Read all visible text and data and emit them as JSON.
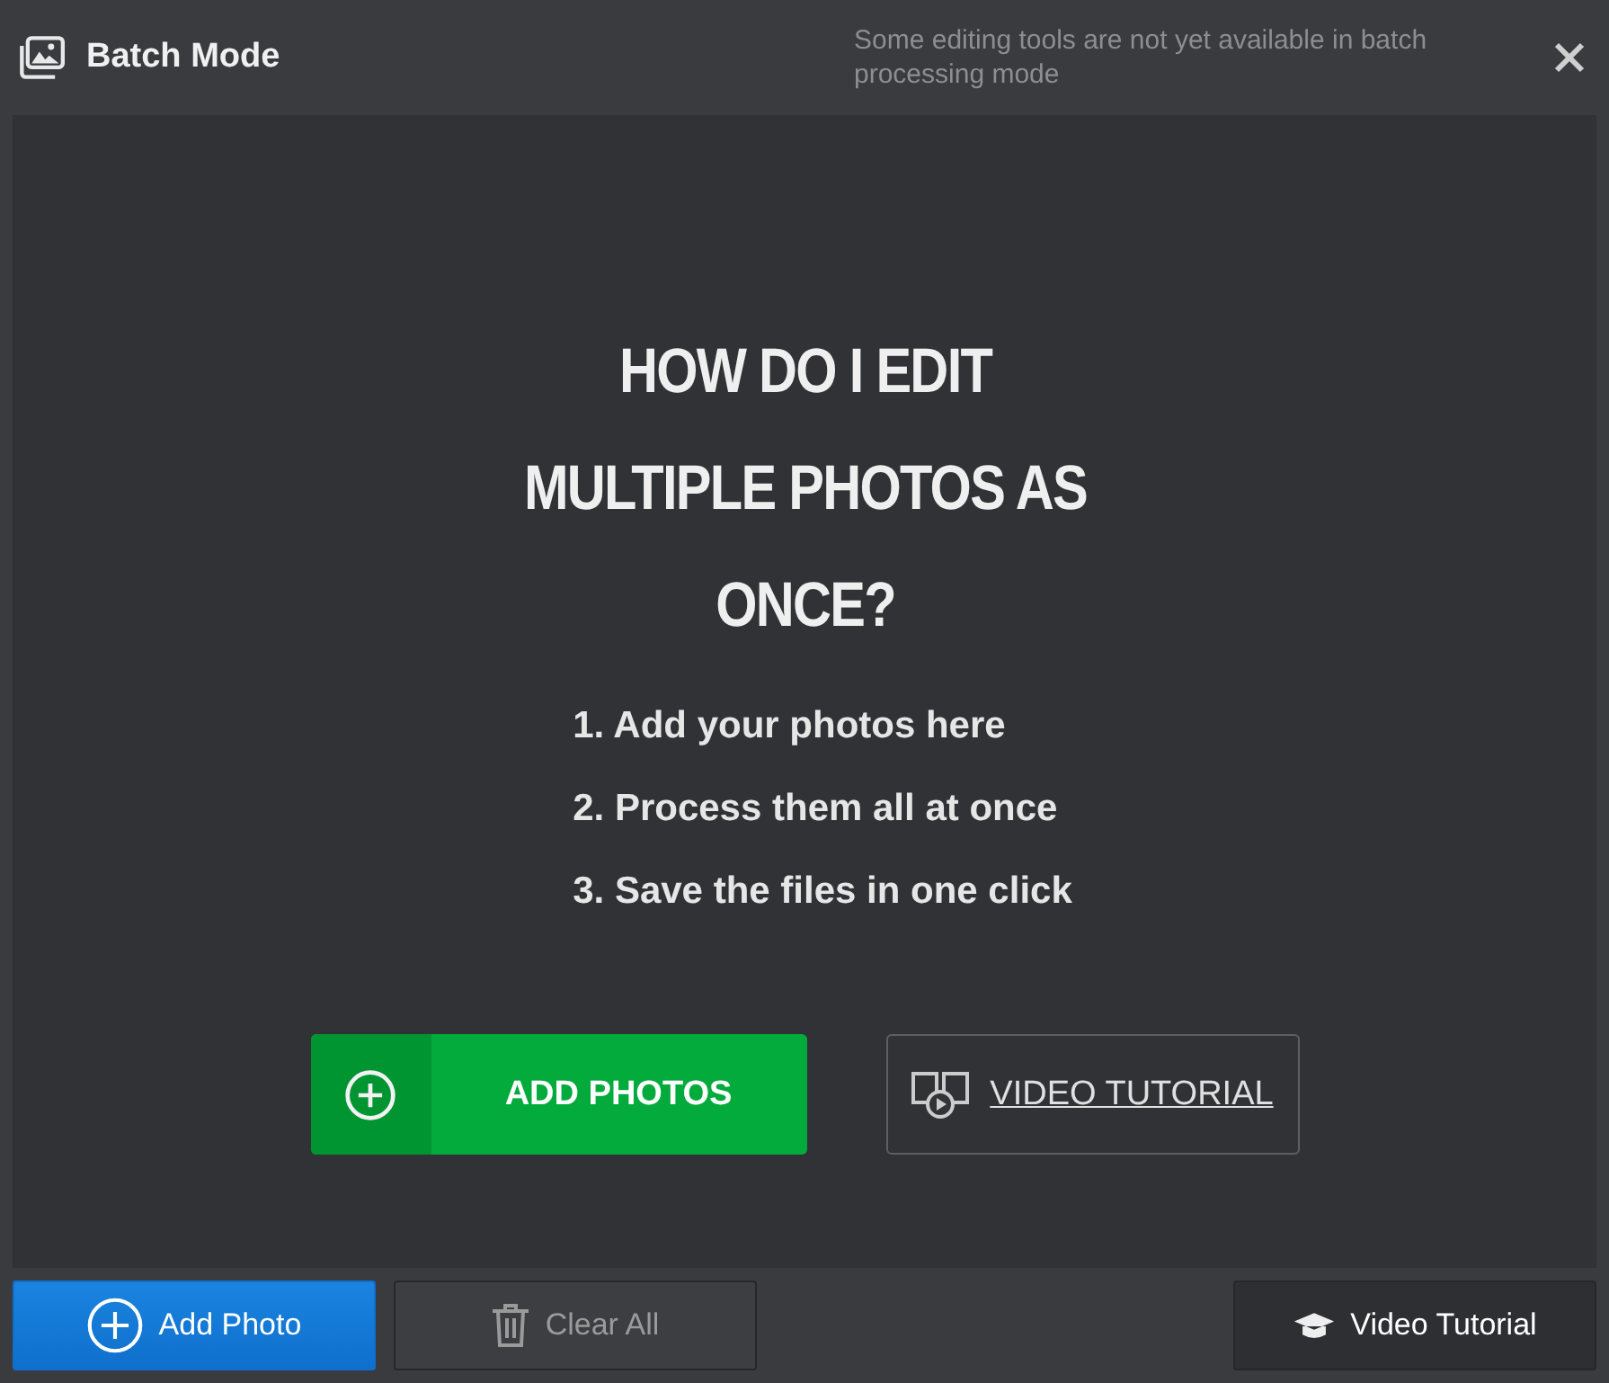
{
  "window": {
    "title": "Batch Mode",
    "notice": "Some editing tools are not yet available in batch processing mode"
  },
  "intro": {
    "heading": "HOW DO I EDIT MULTIPLE PHOTOS AS ONCE?",
    "steps": [
      "1. Add your photos here",
      "2. Process them all at once",
      "3. Save the files in one click"
    ],
    "primary_button": "ADD PHOTOS",
    "secondary_button": "VIDEO TUTORIAL"
  },
  "bottom_bar": [
    {
      "kind": "add",
      "label": "Add Photo",
      "disabled": false
    },
    {
      "kind": "clear",
      "label": "Clear All",
      "disabled": true
    },
    {
      "kind": "tutorial",
      "label": "Video Tutorial",
      "disabled": false
    }
  ]
}
